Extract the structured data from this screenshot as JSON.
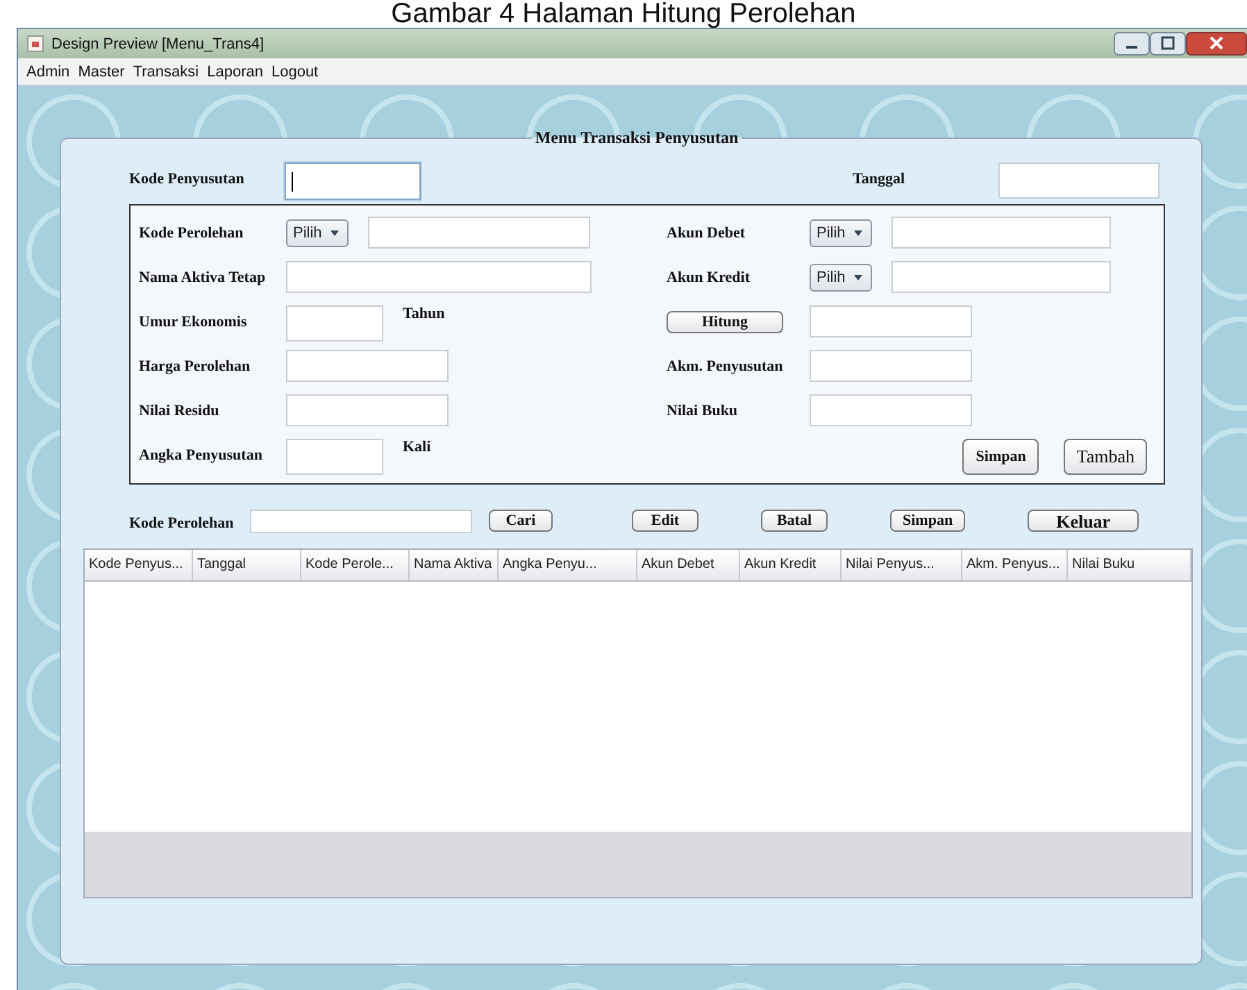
{
  "caption": "Gambar 4 Halaman Hitung Perolehan",
  "window": {
    "title": "Design Preview [Menu_Trans4]"
  },
  "menu": [
    {
      "label": "Admin"
    },
    {
      "label": "Master"
    },
    {
      "label": "Transaksi"
    },
    {
      "label": "Laporan"
    },
    {
      "label": "Logout"
    }
  ],
  "panel": {
    "title": "Menu Transaksi Penyusutan",
    "kode_penyusutan": {
      "label": "Kode Penyusutan",
      "focused": true
    },
    "tanggal": {
      "label": "Tanggal"
    },
    "left_rows": [
      {
        "kind": "combo",
        "label": "Kode Perolehan",
        "combo": "Pilih"
      },
      {
        "kind": "wide",
        "label": "Nama Aktiva Tetap"
      },
      {
        "kind": "unit",
        "label": "Umur Ekonomis",
        "unit": "Tahun"
      },
      {
        "kind": "medium",
        "label": "Harga Perolehan"
      },
      {
        "kind": "medium",
        "label": "Nilai Residu"
      },
      {
        "kind": "unit",
        "label": "Angka Penyusutan",
        "unit": "Kali"
      }
    ],
    "right_rows": [
      {
        "kind": "combo",
        "label": "Akun Debet",
        "combo": "Pilih"
      },
      {
        "kind": "combo",
        "label": "Akun Kredit",
        "combo": "Pilih"
      },
      {
        "kind": "button",
        "label": "Hitung"
      },
      {
        "kind": "medium",
        "label": "Akm. Penyusutan"
      },
      {
        "kind": "medium",
        "label": "Nilai Buku"
      }
    ],
    "box_buttons": [
      "Simpan",
      "Tambah"
    ],
    "search": {
      "label": "Kode Perolehan",
      "button": "Cari"
    },
    "actions": [
      "Edit",
      "Batal",
      "Simpan",
      "Keluar"
    ],
    "table": {
      "columns": [
        "Kode Penyus...",
        "Tanggal",
        "Kode Perole...",
        "Nama Aktiva",
        "Angka Penyu...",
        "Akun Debet",
        "Akun Kredit",
        "Nilai Penyus...",
        "Akm. Penyus...",
        "Nilai Buku"
      ]
    }
  }
}
